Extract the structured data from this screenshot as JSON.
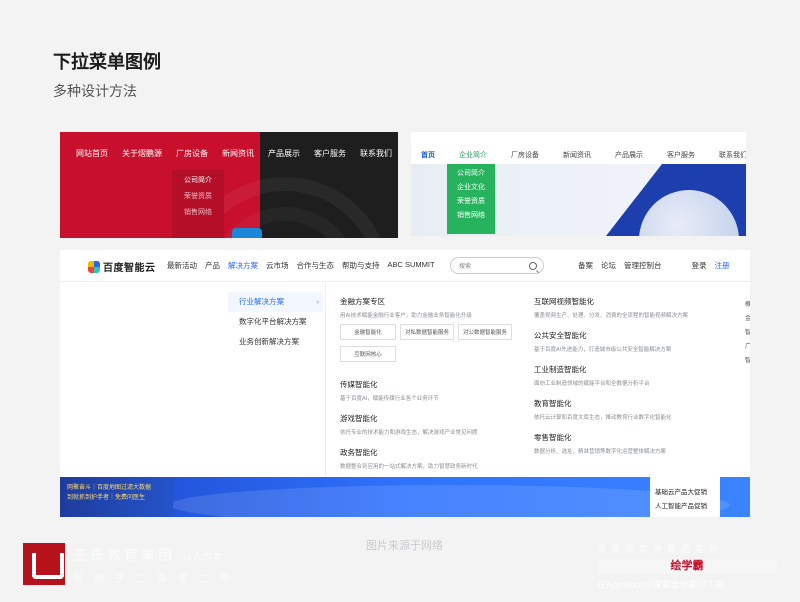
{
  "heading": {
    "title": "下拉菜单图例",
    "subtitle": "多种设计方法"
  },
  "example1": {
    "nav": [
      "网站首页",
      "关于熠鹏源",
      "厂房设备",
      "新闻资讯",
      "产品展示",
      "客户服务",
      "联系我们"
    ],
    "active_index": 1,
    "dropdown": [
      "公司简介",
      "荣誉资质",
      "销售网络"
    ],
    "colors": {
      "primary": "#c8102e",
      "dark": "#1e1e1e"
    }
  },
  "example2": {
    "nav": [
      "首页",
      "企业简介",
      "厂房设备",
      "新闻资讯",
      "产品展示",
      "客户服务",
      "联系我们"
    ],
    "active_index": 0,
    "highlight_index": 1,
    "dropdown": [
      "公司简介",
      "企业文化",
      "荣誉资质",
      "销售网络"
    ],
    "colors": {
      "accent": "#27b35e",
      "brand": "#1d3fae"
    }
  },
  "example3": {
    "logo": "百度智能云",
    "menu": [
      "最新活动",
      "产品",
      "解决方案",
      "云市场",
      "合作与生态",
      "帮助与支持",
      "ABC SUMMIT"
    ],
    "active_index": 2,
    "search_placeholder": "搜索",
    "right_links": [
      "备案",
      "论坛",
      "管理控制台"
    ],
    "login": "登录",
    "register": "注册",
    "categories": [
      "行业解决方案",
      "数字化平台解决方案",
      "业务创新解决方案"
    ],
    "col1": [
      {
        "title": "金融方案专区",
        "desc": "用AI技术赋能金融行业客户，助力金融业务智能化升级",
        "tags": [
          "金融智能化",
          "对私数据智能服务",
          "对公数据智能服务",
          "互联网核心"
        ]
      },
      {
        "title": "传媒智能化",
        "desc": "基于百度AI，赋能传媒行业各个业务环节"
      },
      {
        "title": "游戏智能化",
        "desc": "依托专业的技术能力和游戏生态，解决游戏产业常见问题"
      },
      {
        "title": "政务智能化",
        "desc": "数据整合到应用的一站式解决方案，助力智慧政务新时代"
      }
    ],
    "col2": [
      {
        "title": "互联网视频智能化",
        "desc": "覆盖视频生产、处理、分发、消费的全流程的智能视频解决方案"
      },
      {
        "title": "公共安全智能化",
        "desc": "基于百度AI先进能力，打造城市级公共安全智能解决方案"
      },
      {
        "title": "工业制造智能化",
        "desc": "面向工业制造领域的赋能平台和全数据分析平台"
      },
      {
        "title": "教育智能化",
        "desc": "依托云计算和百度文库生态，推动教育行业数字化智能化"
      },
      {
        "title": "零售智能化",
        "desc": "数据分析、选址、精准营销等数字化运营整体解决方案"
      }
    ],
    "edge_text": [
      "概",
      "金",
      "智",
      "广",
      "智"
    ],
    "banner_promo": [
      "网聚奋斗｜百度地图过滤大数据",
      "到就抓到护手者｜免费问医生"
    ],
    "banner_side": [
      "基础云产品大促销",
      "人工智能产品促销"
    ],
    "colors": {
      "accent": "#2468f2"
    }
  },
  "credit": "图片来源于网络",
  "watermark_left": {
    "name": "王氏教育集团",
    "tagline": "以人为本",
    "motto": "创始于二零零二年"
  },
  "watermark_right": {
    "line1": "百度搜索学霸君官网",
    "brand": "绘学霸",
    "line3": "在AppStore中搜索绘学霸可下载"
  }
}
